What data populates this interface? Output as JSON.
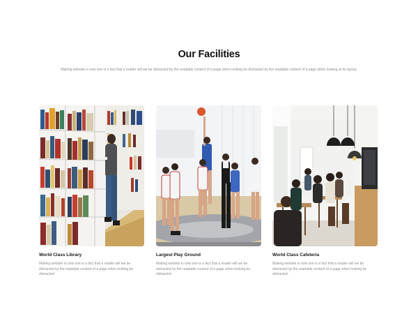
{
  "facilities": {
    "title": "Our Facilities",
    "subtitle": "Making website is now one is a fact that a reader will we be distracted by the readable content of a page when looking be distracted by the readable content of a page when looking at its layout.",
    "cards": [
      {
        "title": "World Class Library",
        "text": "Making website is now one is a fact that a reader will we be distracted by the readable content of a page when looking be distracted.",
        "image": "library-photo"
      },
      {
        "title": "Largest Play Ground",
        "text": "Making website is now one is a fact that a reader will we be distracted by the readable content of a page when looking be distracted.",
        "image": "basketball-photo"
      },
      {
        "title": "World Class Cafeteria",
        "text": "Making website is now one is a fact that a reader will we be distracted by the readable content of a page when looking be distracted.",
        "image": "cafeteria-photo"
      }
    ]
  }
}
